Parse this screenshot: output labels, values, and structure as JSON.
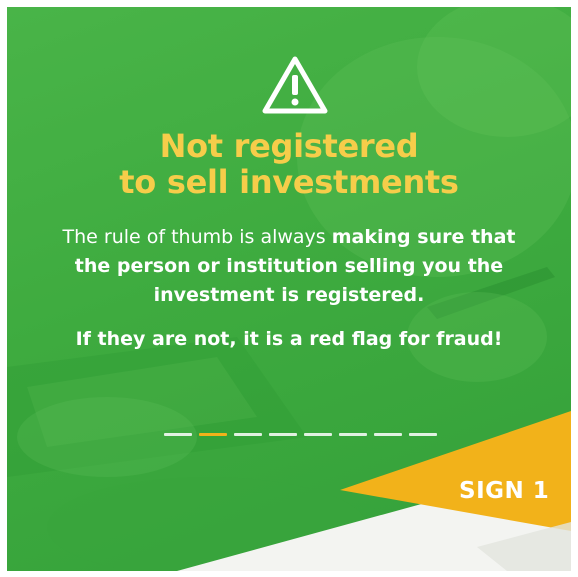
{
  "headline": {
    "line1": "Not registered",
    "line2": "to sell investments"
  },
  "body": {
    "line1_normal": "The rule of thumb is always ",
    "line1_bold": "making sure that",
    "line2_bold": "the person or institution selling you the",
    "line3_bold": "investment is registered."
  },
  "red_flag_text": "If they are not, it is a red flag for fraud!",
  "pagination": {
    "total": 8,
    "active_index": 1
  },
  "sign_label": "SIGN 1",
  "icon": "warning-triangle-icon",
  "colors": {
    "background_green": "#42ad41",
    "headline_yellow": "#f6cd4a",
    "banner_yellow": "#f2b21a",
    "text_white": "#ffffff"
  }
}
